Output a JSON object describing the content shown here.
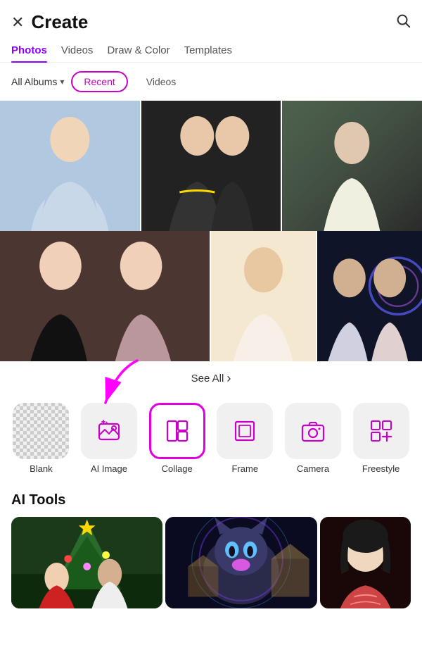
{
  "header": {
    "title": "Create",
    "close_label": "×",
    "search_label": "🔍"
  },
  "nav": {
    "tabs": [
      {
        "id": "photos",
        "label": "Photos",
        "active": true
      },
      {
        "id": "videos",
        "label": "Videos",
        "active": false
      },
      {
        "id": "draw-color",
        "label": "Draw & Color",
        "active": false
      },
      {
        "id": "templates",
        "label": "Templates",
        "active": false
      }
    ]
  },
  "filters": {
    "dropdown_label": "All Albums",
    "pills": [
      {
        "id": "recent",
        "label": "Recent",
        "active": true
      },
      {
        "id": "videos",
        "label": "Videos",
        "active": false
      }
    ]
  },
  "see_all": {
    "label": "See All",
    "chevron": "›"
  },
  "tools": [
    {
      "id": "blank",
      "label": "Blank",
      "icon": "blank",
      "highlighted": false
    },
    {
      "id": "ai-image",
      "label": "AI Image",
      "icon": "ai",
      "highlighted": false
    },
    {
      "id": "collage",
      "label": "Collage",
      "icon": "collage",
      "highlighted": true
    },
    {
      "id": "frame",
      "label": "Frame",
      "icon": "frame",
      "highlighted": false
    },
    {
      "id": "camera",
      "label": "Camera",
      "icon": "camera",
      "highlighted": false
    },
    {
      "id": "freestyle",
      "label": "Freestyle",
      "icon": "freestyle",
      "highlighted": false
    }
  ],
  "ai_tools": {
    "section_title": "AI Tools",
    "items": [
      {
        "id": "ai-tool-1",
        "label": ""
      },
      {
        "id": "ai-tool-2",
        "label": ""
      },
      {
        "id": "ai-tool-3",
        "label": ""
      }
    ]
  }
}
